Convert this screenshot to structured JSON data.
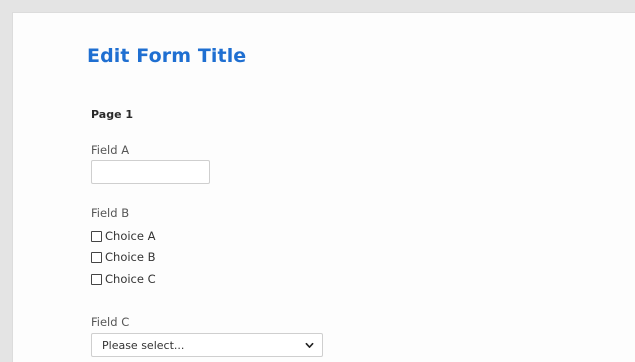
{
  "form": {
    "title": "Edit Form Title",
    "page_label": "Page 1",
    "field_a": {
      "label": "Field A",
      "value": ""
    },
    "field_b": {
      "label": "Field B",
      "choices": [
        "Choice A",
        "Choice B",
        "Choice C"
      ]
    },
    "field_c": {
      "label": "Field C",
      "selected": "Please select..."
    }
  },
  "icons": {
    "checkbox": "checkbox-icon",
    "dropdown": "chevron-down-icon"
  },
  "colors": {
    "title": "#1f6fd1",
    "background": "#fdfdfd"
  }
}
